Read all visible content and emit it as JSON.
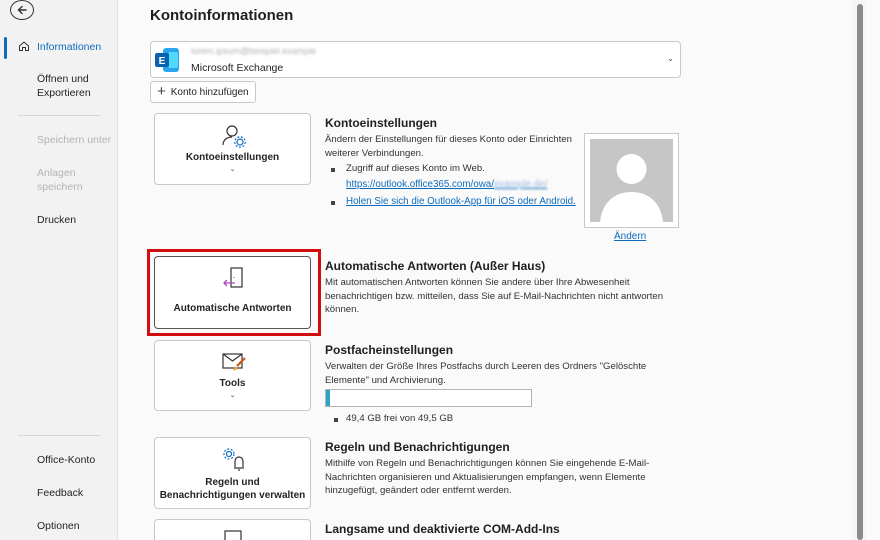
{
  "sidebar": {
    "back_label": "",
    "items": [
      {
        "label": "Informationen"
      },
      {
        "label": "Öffnen und Exportieren"
      },
      {
        "label": "Speichern unter"
      },
      {
        "label": "Anlagen speichern"
      },
      {
        "label": "Drucken"
      },
      {
        "label": "Office-Konto"
      },
      {
        "label": "Feedback"
      },
      {
        "label": "Optionen"
      }
    ]
  },
  "main": {
    "title": "Kontoinformationen",
    "account": {
      "email": "lorem.ipsum@beispiel.example",
      "type": "Microsoft Exchange"
    },
    "add_account_label": "Konto hinzufügen",
    "sections": {
      "account_settings": {
        "tile_label": "Kontoeinstellungen",
        "title": "Kontoeinstellungen",
        "desc": "Ändern der Einstellungen für dieses Konto oder Einrichten weiterer Verbindungen.",
        "bullet": "Zugriff auf dieses Konto im Web.",
        "web_link": "https://outlook.office365.com/owa/",
        "web_link_blur": "example.de/",
        "app_link": "Holen Sie sich die Outlook-App für iOS oder Android.",
        "change_photo": "Ändern"
      },
      "auto_reply": {
        "tile_label": "Automatische Antworten",
        "title": "Automatische Antworten (Außer Haus)",
        "desc": "Mit automatischen Antworten können Sie andere über Ihre Abwesenheit benachrichtigen bzw. mitteilen, dass Sie auf E-Mail-Nachrichten nicht antworten können."
      },
      "mailbox": {
        "tile_label": "Tools",
        "title": "Postfacheinstellungen",
        "desc": "Verwalten der Größe Ihres Postfachs durch Leeren des Ordners \"Gelöschte Elemente\" und Archivierung.",
        "quota_text": "49,4 GB frei von 49,5 GB",
        "used_fraction": 0.02
      },
      "rules": {
        "tile_label_1": "Regeln und",
        "tile_label_2": "Benachrichtigungen verwalten",
        "title": "Regeln und Benachrichtigungen",
        "desc": "Mithilfe von Regeln und Benachrichtigungen können Sie eingehende E-Mail-Nachrichten organisieren und Aktualisierungen empfangen, wenn Elemente hinzugefügt, geändert oder entfernt werden."
      },
      "com_addins": {
        "title": "Langsame und deaktivierte COM-Add-Ins"
      }
    }
  },
  "colors": {
    "accent": "#0f6cbd",
    "highlight": "#d10d0d",
    "progress": "#2fa4c4"
  }
}
